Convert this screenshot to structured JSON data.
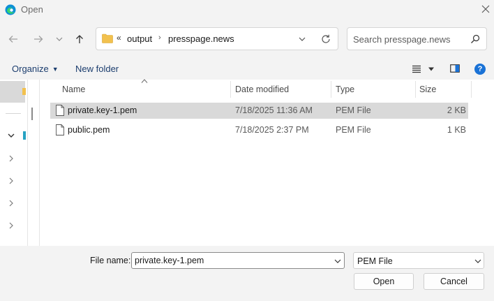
{
  "window": {
    "title": "Open",
    "icon": "edge-browser-icon",
    "close_icon": "close-icon"
  },
  "navigation": {
    "back_icon": "arrow-left-icon",
    "forward_icon": "arrow-right-icon",
    "recent_icon": "chevron-down-icon",
    "up_icon": "arrow-up-icon"
  },
  "address_bar": {
    "overflow_glyph": "«",
    "breadcrumbs": [
      "output",
      "presspage.news"
    ],
    "separator": "›",
    "folder_icon": "folder-icon",
    "dropdown_icon": "chevron-down-icon",
    "refresh_icon": "refresh-icon"
  },
  "search": {
    "placeholder": "Search presspage.news",
    "icon": "search-icon"
  },
  "command_bar": {
    "organize_label": "Organize",
    "new_folder_label": "New folder",
    "view_icon": "list-view-icon",
    "preview_pane_icon": "preview-pane-icon",
    "help_label": "?"
  },
  "file_list": {
    "columns": [
      "Name",
      "Date modified",
      "Type",
      "Size"
    ],
    "rows": [
      {
        "name": "private.key-1.pem",
        "date": "7/18/2025 11:36 AM",
        "type": "PEM File",
        "size": "2 KB",
        "selected": true
      },
      {
        "name": "public.pem",
        "date": "7/18/2025 2:37 PM",
        "type": "PEM File",
        "size": "1 KB",
        "selected": false
      }
    ]
  },
  "footer": {
    "file_name_label": "File name:",
    "file_name_value": "private.key-1.pem",
    "file_type_value": "PEM File",
    "open_label": "Open",
    "cancel_label": "Cancel"
  },
  "colors": {
    "background": "#f3f3f3",
    "selected_row": "#d9d9d9",
    "accent": "#1a72d6",
    "folder": "#f2c14e"
  }
}
